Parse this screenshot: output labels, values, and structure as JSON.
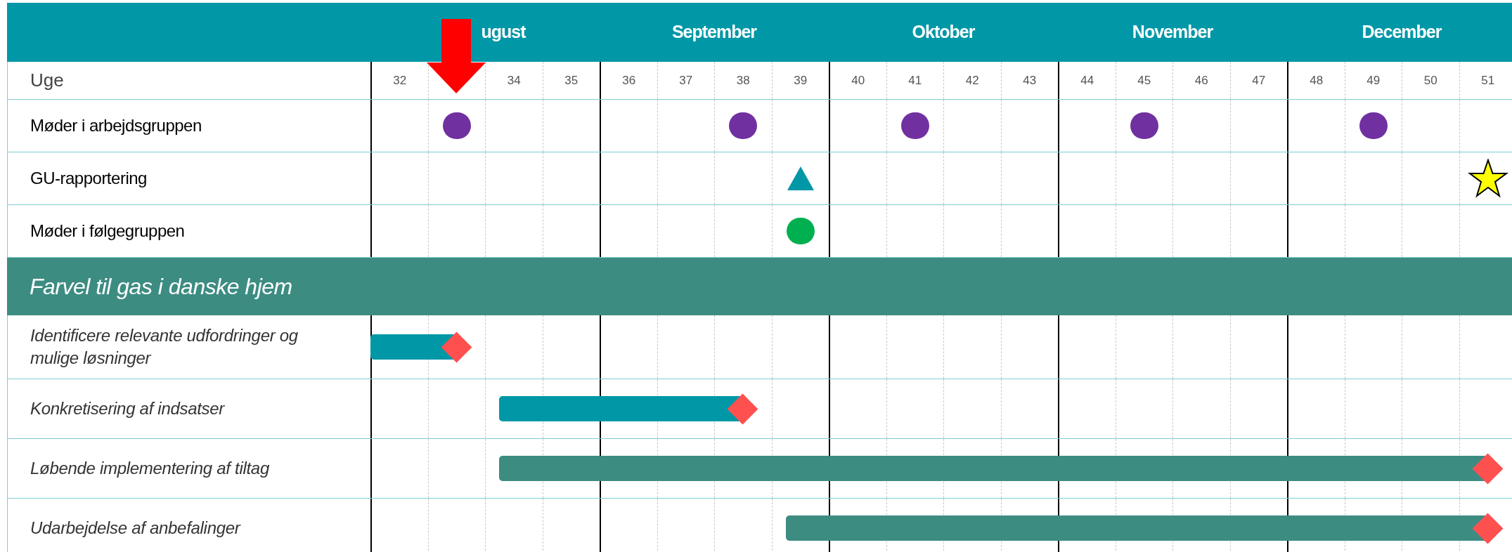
{
  "timeline": {
    "months": [
      {
        "label": "ugust"
      },
      {
        "label": "September"
      },
      {
        "label": "Oktober"
      },
      {
        "label": "November"
      },
      {
        "label": "December"
      }
    ],
    "week_header": "Uge",
    "weeks": [
      {
        "label": "32",
        "current": false
      },
      {
        "current": true
      },
      {
        "label": "34",
        "current": false
      },
      {
        "label": "35",
        "current": false
      },
      {
        "label": "36",
        "current": false
      },
      {
        "label": "37",
        "current": false
      },
      {
        "label": "38",
        "current": false
      },
      {
        "label": "39",
        "current": false
      },
      {
        "label": "40",
        "current": false
      },
      {
        "label": "41",
        "current": false
      },
      {
        "label": "42",
        "current": false
      },
      {
        "label": "43",
        "current": false
      },
      {
        "label": "44",
        "current": false
      },
      {
        "label": "45",
        "current": false
      },
      {
        "label": "46",
        "current": false
      },
      {
        "label": "47",
        "current": false
      },
      {
        "label": "48",
        "current": false
      },
      {
        "label": "49",
        "current": false
      },
      {
        "label": "50",
        "current": false
      },
      {
        "label": "51",
        "current": false
      }
    ]
  },
  "milestone_rows": [
    {
      "label": "Møder i arbejdsgruppen",
      "cells": [
        {
          "kind": "none"
        },
        {
          "kind": "circle",
          "color": "#7030a0"
        },
        {
          "kind": "none"
        },
        {
          "kind": "none"
        },
        {
          "kind": "none"
        },
        {
          "kind": "none"
        },
        {
          "kind": "circle",
          "color": "#7030a0"
        },
        {
          "kind": "none"
        },
        {
          "kind": "none"
        },
        {
          "kind": "circle",
          "color": "#7030a0"
        },
        {
          "kind": "none"
        },
        {
          "kind": "none"
        },
        {
          "kind": "none"
        },
        {
          "kind": "circle",
          "color": "#7030a0"
        },
        {
          "kind": "none"
        },
        {
          "kind": "none"
        },
        {
          "kind": "none"
        },
        {
          "kind": "circle",
          "color": "#7030a0"
        },
        {
          "kind": "none"
        },
        {
          "kind": "none"
        }
      ]
    },
    {
      "label": "GU-rapportering",
      "cells": [
        {
          "kind": "none"
        },
        {
          "kind": "none"
        },
        {
          "kind": "none"
        },
        {
          "kind": "none"
        },
        {
          "kind": "none"
        },
        {
          "kind": "none"
        },
        {
          "kind": "none"
        },
        {
          "kind": "triangle",
          "color": "#0097a7"
        },
        {
          "kind": "none"
        },
        {
          "kind": "none"
        },
        {
          "kind": "none"
        },
        {
          "kind": "none"
        },
        {
          "kind": "none"
        },
        {
          "kind": "none"
        },
        {
          "kind": "none"
        },
        {
          "kind": "none"
        },
        {
          "kind": "none"
        },
        {
          "kind": "none"
        },
        {
          "kind": "none"
        },
        {
          "kind": "star",
          "color": "#ffff00"
        }
      ]
    },
    {
      "label": "Møder i følgegruppen",
      "cells": [
        {
          "kind": "none"
        },
        {
          "kind": "none"
        },
        {
          "kind": "none"
        },
        {
          "kind": "none"
        },
        {
          "kind": "none"
        },
        {
          "kind": "none"
        },
        {
          "kind": "none"
        },
        {
          "kind": "circle",
          "color": "#00b050"
        },
        {
          "kind": "none"
        },
        {
          "kind": "none"
        },
        {
          "kind": "none"
        },
        {
          "kind": "none"
        },
        {
          "kind": "none"
        },
        {
          "kind": "none"
        },
        {
          "kind": "none"
        },
        {
          "kind": "none"
        },
        {
          "kind": "none"
        },
        {
          "kind": "none"
        },
        {
          "kind": "none"
        },
        {
          "kind": "none"
        }
      ]
    }
  ],
  "section": {
    "title": "Farvel til gas i danske hjem"
  },
  "tasks": [
    {
      "label": "Identificere relevante udfordringer og mulige løsninger",
      "color": "#0097a7",
      "cells": [
        {
          "kind": "bar"
        },
        {
          "kind": "end"
        },
        {
          "kind": "none"
        },
        {
          "kind": "none"
        },
        {
          "kind": "none"
        },
        {
          "kind": "none"
        },
        {
          "kind": "none"
        },
        {
          "kind": "none"
        },
        {
          "kind": "none"
        },
        {
          "kind": "none"
        },
        {
          "kind": "none"
        },
        {
          "kind": "none"
        },
        {
          "kind": "none"
        },
        {
          "kind": "none"
        },
        {
          "kind": "none"
        },
        {
          "kind": "none"
        },
        {
          "kind": "none"
        },
        {
          "kind": "none"
        },
        {
          "kind": "none"
        },
        {
          "kind": "none"
        }
      ]
    },
    {
      "label": "Konkretisering af indsatser",
      "color": "#0097a7",
      "cells": [
        {
          "kind": "none"
        },
        {
          "kind": "none"
        },
        {
          "kind": "bar"
        },
        {
          "kind": "bar"
        },
        {
          "kind": "bar"
        },
        {
          "kind": "bar"
        },
        {
          "kind": "end"
        },
        {
          "kind": "none"
        },
        {
          "kind": "none"
        },
        {
          "kind": "none"
        },
        {
          "kind": "none"
        },
        {
          "kind": "none"
        },
        {
          "kind": "none"
        },
        {
          "kind": "none"
        },
        {
          "kind": "none"
        },
        {
          "kind": "none"
        },
        {
          "kind": "none"
        },
        {
          "kind": "none"
        },
        {
          "kind": "none"
        },
        {
          "kind": "none"
        }
      ]
    },
    {
      "label": "Løbende implementering af tiltag",
      "color": "#3d8c82",
      "cells": [
        {
          "kind": "none"
        },
        {
          "kind": "none"
        },
        {
          "kind": "bar"
        },
        {
          "kind": "bar"
        },
        {
          "kind": "bar"
        },
        {
          "kind": "bar"
        },
        {
          "kind": "bar"
        },
        {
          "kind": "bar"
        },
        {
          "kind": "bar"
        },
        {
          "kind": "bar"
        },
        {
          "kind": "bar"
        },
        {
          "kind": "bar"
        },
        {
          "kind": "bar"
        },
        {
          "kind": "bar"
        },
        {
          "kind": "bar"
        },
        {
          "kind": "bar"
        },
        {
          "kind": "bar"
        },
        {
          "kind": "bar"
        },
        {
          "kind": "bar"
        },
        {
          "kind": "end"
        }
      ]
    },
    {
      "label": "Udarbejdelse af anbefalinger",
      "color": "#3d8c82",
      "cells": [
        {
          "kind": "none"
        },
        {
          "kind": "none"
        },
        {
          "kind": "none"
        },
        {
          "kind": "none"
        },
        {
          "kind": "none"
        },
        {
          "kind": "none"
        },
        {
          "kind": "none"
        },
        {
          "kind": "bar"
        },
        {
          "kind": "bar"
        },
        {
          "kind": "bar"
        },
        {
          "kind": "bar"
        },
        {
          "kind": "bar"
        },
        {
          "kind": "bar"
        },
        {
          "kind": "bar"
        },
        {
          "kind": "bar"
        },
        {
          "kind": "bar"
        },
        {
          "kind": "bar"
        },
        {
          "kind": "bar"
        },
        {
          "kind": "bar"
        },
        {
          "kind": "end"
        }
      ]
    }
  ]
}
